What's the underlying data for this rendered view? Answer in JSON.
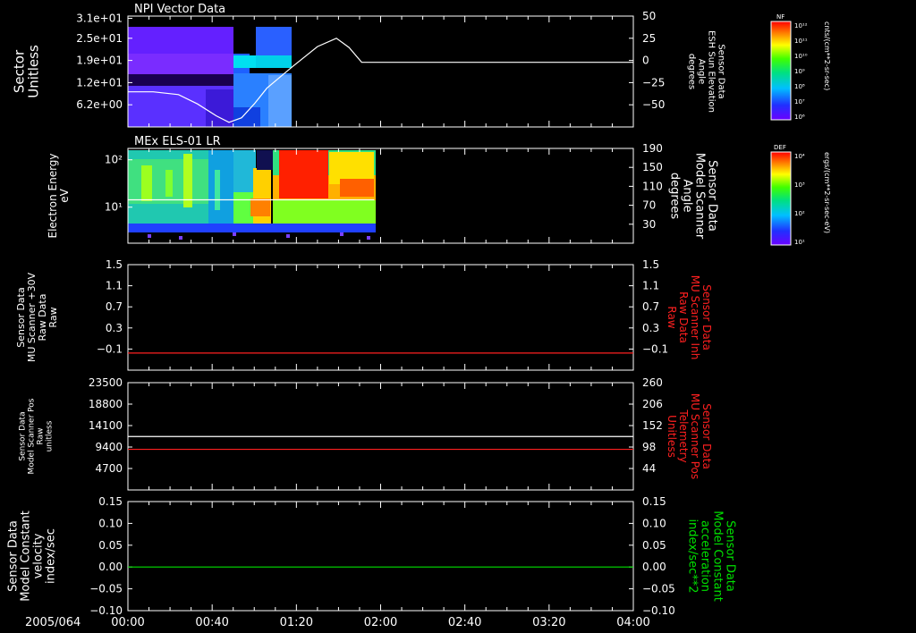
{
  "date_label": "2005/064",
  "x_ticks": [
    "00:00",
    "00:40",
    "01:20",
    "02:00",
    "02:40",
    "03:20",
    "04:00"
  ],
  "colors": {
    "background": "#000000",
    "axis": "#ffffff",
    "red_trace": "#ff2020",
    "green_trace": "#00e000",
    "red_label": "#ff2020",
    "green_label": "#00e000"
  },
  "colorbars": [
    {
      "name": "NF",
      "ticks": [
        "10¹²",
        "10¹¹",
        "10¹⁰",
        "10⁹",
        "10⁸",
        "10⁷",
        "10⁶"
      ],
      "unit": "cnts/(cm**2-sr-sec)"
    },
    {
      "name": "DEF",
      "ticks": [
        "10⁴",
        "10³",
        "10²",
        "10¹"
      ],
      "unit": "ergs/(cm**2-sr-sec-eV)"
    }
  ],
  "chart_data": [
    {
      "type": "heatmap",
      "title": "NPI Vector Data",
      "left_label": [
        "Sector",
        "Unitless"
      ],
      "right_label": [
        "Sensor Data",
        "ESH Sun Elevation",
        "Angle",
        "degrees"
      ],
      "y_ticks_left": [
        "3.1e+01",
        "2.5e+01",
        "1.9e+01",
        "1.2e+01",
        "6.2e+00"
      ],
      "y_ticks_right": [
        "50",
        "25",
        "0",
        "−25",
        "−50"
      ],
      "ylim_right": [
        -70,
        50
      ],
      "overlay_line": {
        "color": "#ffffff",
        "x_hours": [
          0.0,
          0.2,
          0.4,
          0.55,
          0.7,
          0.8,
          0.9,
          1.0,
          1.1,
          1.3,
          1.5,
          1.65,
          1.75,
          1.85,
          2.0,
          2.5,
          3.0,
          3.5,
          4.0
        ],
        "y_deg": [
          -32,
          -32,
          -35,
          -45,
          -58,
          -65,
          -60,
          -45,
          -28,
          -5,
          17,
          26,
          16,
          0,
          0,
          0,
          0,
          0,
          0
        ]
      },
      "data_extent_hours": [
        0.0,
        1.25
      ]
    },
    {
      "type": "heatmap",
      "title": "MEx ELS-01 LR",
      "left_label": [
        "Electron Energy",
        "eV"
      ],
      "right_label": [
        "Sensor Data",
        "Model Scanner",
        "Angle",
        "degrees"
      ],
      "y_ticks_left": [
        "10²",
        "10¹"
      ],
      "y_ticks_right": [
        "190",
        "150",
        "110",
        "70",
        "30"
      ],
      "ylim_right": [
        0,
        190
      ],
      "overlay_line": {
        "color": "#ffffff",
        "value_deg": 87,
        "x_range_hours": [
          0.0,
          1.95
        ]
      },
      "data_extent_hours": [
        0.0,
        1.95
      ]
    },
    {
      "type": "line",
      "left_label": [
        "Sensor Data",
        "MU Scanner +30V",
        "Raw Data",
        "Raw"
      ],
      "right_label": [
        "Sensor Data",
        "MU Scanner Inh",
        "Raw Data",
        "Raw"
      ],
      "y_ticks_left": [
        "1.5",
        "1.1",
        "0.7",
        "0.3",
        "−0.1"
      ],
      "y_ticks_right": [
        "1.5",
        "1.1",
        "0.7",
        "0.3",
        "−0.1"
      ],
      "ylim": [
        -0.35,
        1.5
      ],
      "series": [
        {
          "color": "#ff2020",
          "value": -0.05
        }
      ]
    },
    {
      "type": "line",
      "left_label": [
        "Sensor Data",
        "Model Scanner Pos",
        "Raw",
        "unitless"
      ],
      "right_label": [
        "Sensor Data",
        "MU Scanner Pos",
        "Telemetry",
        "Unitless"
      ],
      "y_ticks_left": [
        "23500",
        "18800",
        "14100",
        "9400",
        "4700"
      ],
      "y_ticks_right": [
        "260",
        "206",
        "152",
        "98",
        "44"
      ],
      "ylim_left": [
        0,
        23500
      ],
      "series": [
        {
          "color": "#ffffff",
          "value": 11700
        },
        {
          "color": "#ff2020",
          "value": 8900
        }
      ]
    },
    {
      "type": "line",
      "left_label": [
        "Sensor Data",
        "Model Constant",
        "velocity",
        "index/sec"
      ],
      "right_label": [
        "Sensor Data",
        "Model Constant",
        "acceleration",
        "index/sec**2"
      ],
      "y_ticks_left": [
        "0.15",
        "0.10",
        "0.05",
        "0.00",
        "−0.05",
        "−0.10"
      ],
      "y_ticks_right": [
        "0.15",
        "0.10",
        "0.05",
        "0.00",
        "−0.05",
        "−0.10"
      ],
      "ylim": [
        -0.1,
        0.15
      ],
      "series": [
        {
          "color": "#00e000",
          "value": 0.0
        }
      ]
    }
  ]
}
